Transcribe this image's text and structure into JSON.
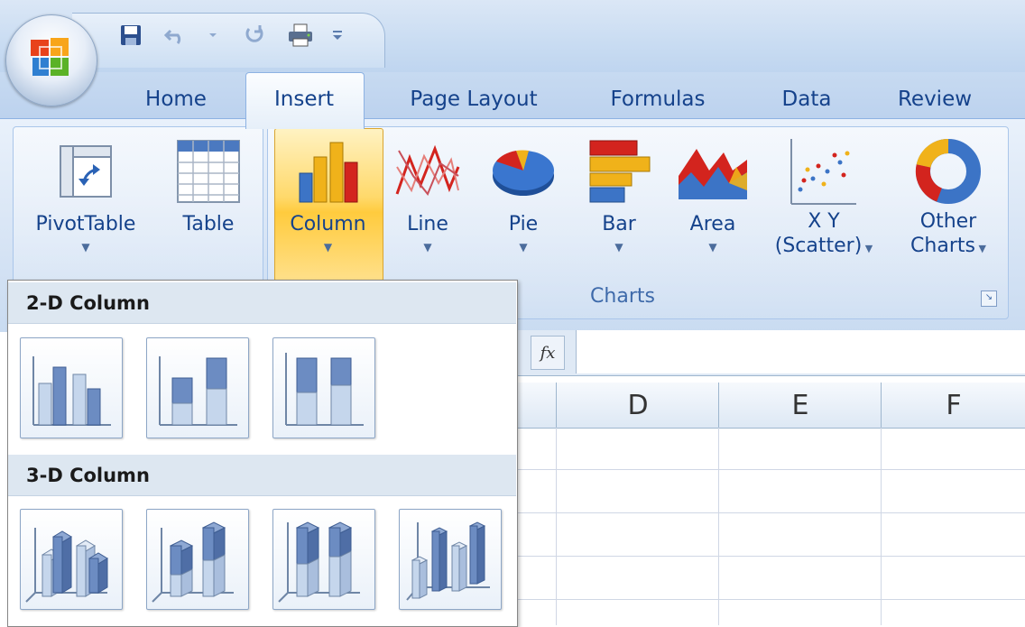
{
  "ribbon": {
    "tabs": [
      "Home",
      "Insert",
      "Page Layout",
      "Formulas",
      "Data",
      "Review"
    ],
    "active_tab": "Insert",
    "tables_group": {
      "buttons": [
        {
          "label": "PivotTable",
          "icon": "pivottable-icon",
          "has_dropdown": true
        },
        {
          "label": "Table",
          "icon": "table-icon",
          "has_dropdown": false
        }
      ]
    },
    "charts_group": {
      "label": "Charts",
      "buttons": [
        {
          "label": "Column",
          "icon": "column-chart-icon",
          "has_dropdown": true,
          "active": true
        },
        {
          "label": "Line",
          "icon": "line-chart-icon",
          "has_dropdown": true
        },
        {
          "label": "Pie",
          "icon": "pie-chart-icon",
          "has_dropdown": true
        },
        {
          "label": "Bar",
          "icon": "bar-chart-icon",
          "has_dropdown": true
        },
        {
          "label": "Area",
          "icon": "area-chart-icon",
          "has_dropdown": true
        },
        {
          "label_line1": "X Y",
          "label_line2": "(Scatter)",
          "icon": "scatter-chart-icon",
          "has_dropdown": true
        },
        {
          "label_line1": "Other",
          "label_line2": "Charts",
          "icon": "doughnut-chart-icon",
          "has_dropdown": true
        }
      ]
    }
  },
  "formula_bar": {
    "fx_label": "fx",
    "value": ""
  },
  "grid": {
    "columns": [
      "D",
      "E",
      "F"
    ]
  },
  "dropdown": {
    "sections": [
      {
        "title": "2-D Column",
        "items": [
          "clustered-column-icon",
          "stacked-column-icon",
          "100-percent-stacked-column-icon"
        ]
      },
      {
        "title": "3-D Column",
        "items": [
          "3d-clustered-column-icon",
          "3d-stacked-column-icon",
          "3d-100-percent-stacked-column-icon",
          "3d-column-icon"
        ]
      }
    ]
  },
  "colors": {
    "ribbon_text": "#15428b",
    "active_button": "#ffcb3e",
    "accent_blue": "#8db2e3"
  }
}
